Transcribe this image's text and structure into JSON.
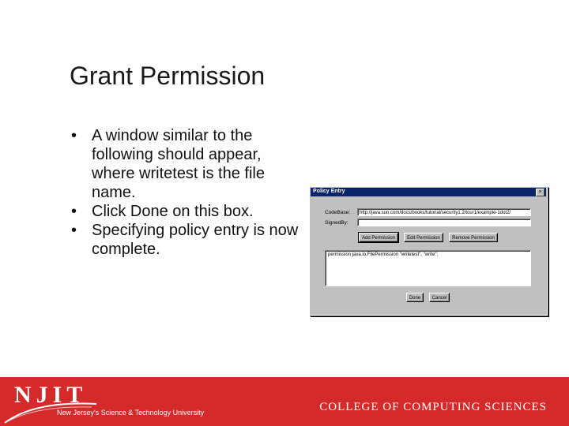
{
  "slide": {
    "title": "Grant Permission",
    "bullets": [
      {
        "marker": "•",
        "text": "A window similar to the following should appear, where writetest is the file name."
      },
      {
        "marker": "•",
        "text": "Click Done on this box."
      },
      {
        "marker": "•",
        "text": "Specifying policy entry is now complete."
      }
    ]
  },
  "dialog": {
    "title": "Policy Entry",
    "close_glyph": "×",
    "codebase_label": "CodeBase:",
    "codebase_value": "http://java.sun.com/docs/books/tutorial/security1.2/tour1/example-1dot2/",
    "signedby_label": "SignedBy:",
    "signedby_value": "",
    "add_permission": "Add Permission",
    "edit_permission": "Edit Permission",
    "remove_permission": "Remove Permission",
    "permission_entry": "permission java.io.FilePermission \"writetest\", \"write\";",
    "done": "Done",
    "cancel": "Cancel"
  },
  "footer": {
    "logo_text": "NJIT",
    "tagline": "New Jersey's Science & Technology University",
    "college": "COLLEGE OF COMPUTING SCIENCES",
    "colors": {
      "band": "#d42a2a",
      "text": "#ffffff"
    }
  }
}
